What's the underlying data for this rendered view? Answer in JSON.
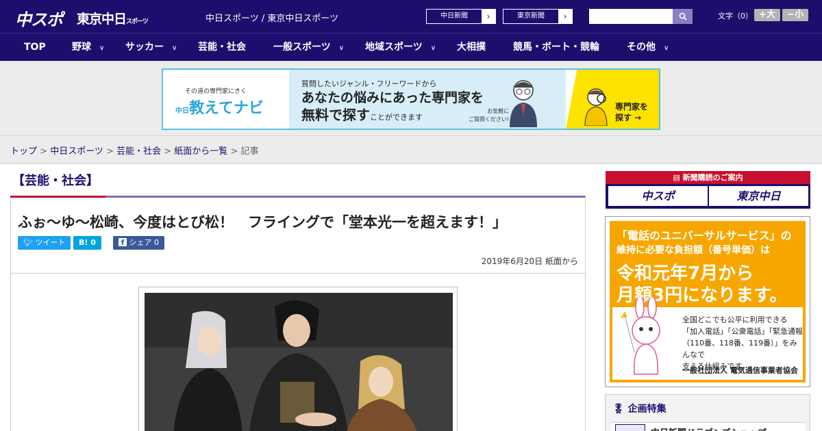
{
  "header": {
    "logo_chuspo": "中スポ",
    "logo_tokyo": "東京中日",
    "logo_tokyo_suffix": "スポーツ",
    "site_names": "中日スポーツ / 東京中日スポーツ",
    "paper_links": [
      "中日新聞",
      "東京新聞"
    ],
    "search_placeholder": "",
    "font_size_label": "文字（0）",
    "font_larger": "+大",
    "font_smaller": "−小"
  },
  "nav": {
    "items": [
      {
        "label": "TOP",
        "dropdown": false
      },
      {
        "label": "野球",
        "dropdown": true
      },
      {
        "label": "サッカー",
        "dropdown": true
      },
      {
        "label": "芸能・社会",
        "dropdown": false
      },
      {
        "label": "一般スポーツ",
        "dropdown": true
      },
      {
        "label": "地域スポーツ",
        "dropdown": true
      },
      {
        "label": "大相撲",
        "dropdown": false
      },
      {
        "label": "競馬・ボート・競輪",
        "dropdown": false
      },
      {
        "label": "その他",
        "dropdown": true
      }
    ]
  },
  "ad_banner": {
    "tagline": "その道の専門家にきく",
    "brand": "教えてナビ",
    "brand_prefix": "中日",
    "line1": "質問したいジャンル・フリーワードから",
    "line2": "あなたの悩みにあった専門家を",
    "line3_main": "無料で探す",
    "line3_sub": "ことができます",
    "note1": "お気軽に",
    "note2": "ご質問ください!",
    "cta1": "専門家を",
    "cta2": "探す →"
  },
  "breadcrumb": {
    "items": [
      "トップ",
      "中日スポーツ",
      "芸能・社会",
      "紙面から一覧"
    ],
    "current": "記事"
  },
  "article": {
    "category": "【芸能・社会】",
    "title": "ふぉ～ゆ～松崎、今度はとび松！　フライングで「堂本光一を超えます！」",
    "share": {
      "tweet": "ツイート",
      "hatena": "B! 0",
      "facebook": "シェア 0"
    },
    "date": "2019年6月20日 紙面から"
  },
  "sidebar": {
    "subscribe_head": "新聞購読のご案内",
    "subscribe_links": [
      "中スポ",
      "東京中日"
    ],
    "uni_ad": {
      "l1": "「電話のユニバーサルサービス」の",
      "l2": "維持に必要な負担額（番号単価）は",
      "l3": "令和元年7月から",
      "l4": "月額3円になります。",
      "body1": "全国どこでも公平に利用できる",
      "body2": "「加入電話」「公衆電話」「緊急通報",
      "body3": "（110番、118番、119番）」をみんなで",
      "body4": "支える仕組みです。",
      "org": "一般社団法人 電気通信事業者協会"
    },
    "feature_title": "企画特集",
    "feature_item": "中日新聞ドラゴンズショップ"
  },
  "colors": {
    "brand_navy": "#1d0e6e",
    "accent_red": "#c8102e",
    "twitter": "#1da1f2",
    "hatena": "#00a4de",
    "facebook": "#3b5998"
  }
}
